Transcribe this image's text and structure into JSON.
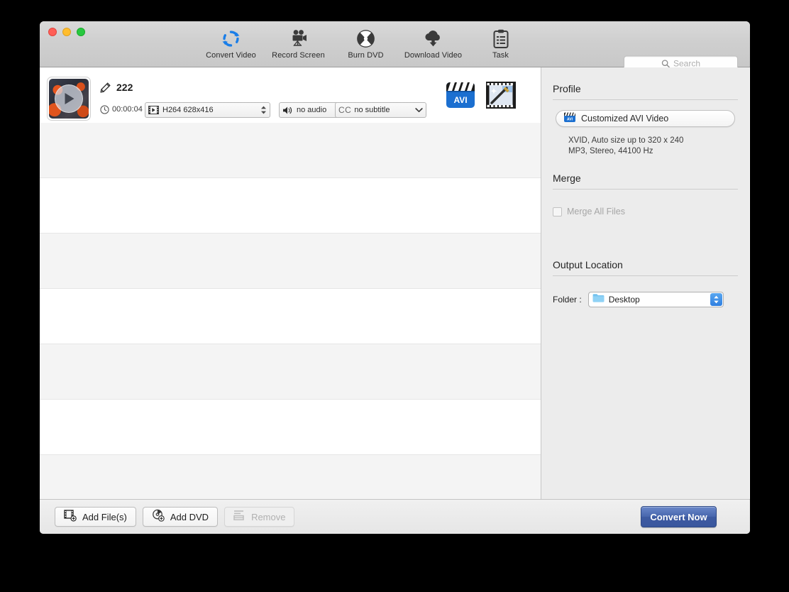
{
  "window": {
    "traffic_lights": [
      "close",
      "minimize",
      "zoom"
    ]
  },
  "toolbar": {
    "items": [
      {
        "label": "Convert Video",
        "icon": "refresh-circle-icon"
      },
      {
        "label": "Record Screen",
        "icon": "video-camera-icon"
      },
      {
        "label": "Burn DVD",
        "icon": "disc-burn-icon"
      },
      {
        "label": "Download Video",
        "icon": "cloud-download-icon"
      },
      {
        "label": "Task",
        "icon": "clipboard-icon"
      }
    ],
    "search": {
      "placeholder": "Search",
      "value": "",
      "icon": "search-icon"
    }
  },
  "file_row": {
    "thumbnail": "video-thumbnail",
    "edit_icon": "pencil-icon",
    "name": "222",
    "clock_icon": "clock-icon",
    "duration": "00:00:04",
    "video_combo": {
      "icon": "film-icon",
      "value": "H264 628x416"
    },
    "audio_combo": {
      "icon": "speaker-icon",
      "value": "no audio"
    },
    "subtitle_combo": {
      "prefix": "CC",
      "value": "no subtitle"
    },
    "format_badge": {
      "label": "AVI",
      "icon": "clapperboard-icon"
    },
    "edit_media_icon": "film-wand-edit-icon"
  },
  "list_rows": [
    {
      "type": "alt"
    },
    {
      "type": "plain"
    },
    {
      "type": "alt"
    },
    {
      "type": "plain"
    },
    {
      "type": "alt"
    },
    {
      "type": "plain"
    },
    {
      "type": "alt"
    }
  ],
  "sidebar": {
    "profile": {
      "title": "Profile",
      "button_label": "Customized AVI Video",
      "button_icon": "avi-clapperboard-icon",
      "description_line1": "XVID, Auto size up to 320 x 240",
      "description_line2": "MP3, Stereo, 44100 Hz"
    },
    "merge": {
      "title": "Merge",
      "checkbox_label": "Merge All Files",
      "checked": false,
      "enabled": false
    },
    "output": {
      "title": "Output Location",
      "folder_label": "Folder :",
      "folder_icon": "folder-icon",
      "folder_value": "Desktop"
    }
  },
  "bottom_bar": {
    "add_files": {
      "label": "Add File(s)",
      "icon": "add-file-icon",
      "enabled": true
    },
    "add_dvd": {
      "label": "Add DVD",
      "icon": "add-dvd-icon",
      "enabled": true
    },
    "remove": {
      "label": "Remove",
      "icon": "remove-icon",
      "enabled": false
    },
    "convert": {
      "label": "Convert Now"
    }
  },
  "colors": {
    "accent_blue": "#1a7ee8",
    "convert_button": "#44639f",
    "stepper_blue": "#3d8ee6",
    "toolbar_bg": "#cfcfcf",
    "sidebar_bg": "#ececec",
    "row_alt": "#f4f4f4"
  }
}
